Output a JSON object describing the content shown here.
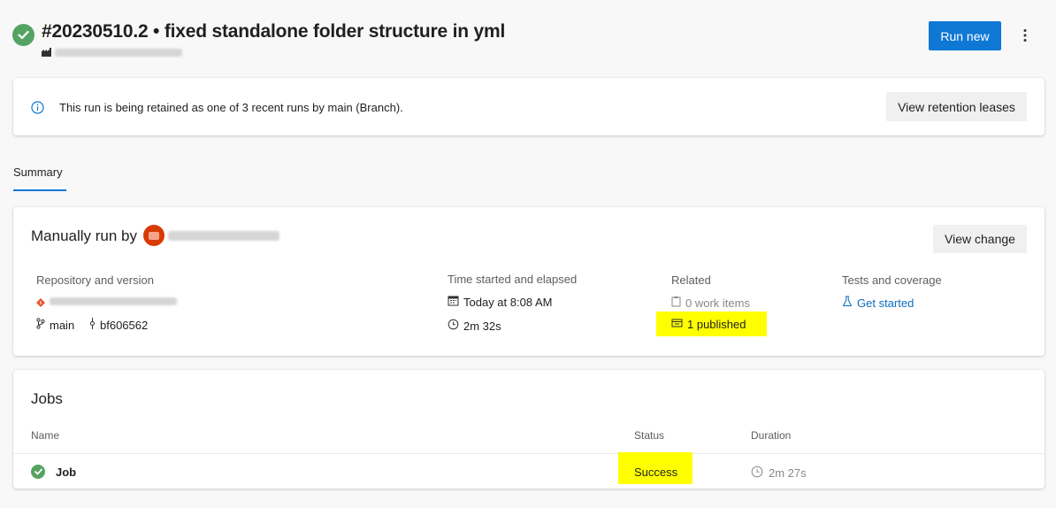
{
  "header": {
    "run_title": "#20230510.2 • fixed standalone folder structure in yml",
    "run_new_label": "Run new",
    "more_icon": "more-vertical-icon"
  },
  "retention": {
    "message": "This run is being retained as one of 3 recent runs by main (Branch).",
    "button_label": "View retention leases"
  },
  "tabs": [
    {
      "label": "Summary",
      "selected": true
    }
  ],
  "summary": {
    "triggered_label": "Manually run by",
    "view_change_label": "View change",
    "repository": {
      "heading": "Repository and version",
      "branch": "main",
      "commit": "bf606562"
    },
    "time": {
      "heading": "Time started and elapsed",
      "started": "Today at 8:08 AM",
      "elapsed": "2m 32s"
    },
    "related": {
      "heading": "Related",
      "work_items": "0 work items",
      "published": "1 published"
    },
    "tests": {
      "heading": "Tests and coverage",
      "get_started": "Get started"
    }
  },
  "jobs": {
    "title": "Jobs",
    "columns": {
      "name": "Name",
      "status": "Status",
      "duration": "Duration"
    },
    "rows": [
      {
        "name": "Job",
        "status": "Success",
        "duration": "2m 27s"
      }
    ]
  },
  "colors": {
    "accent": "#0f78d4",
    "success": "#55a362",
    "highlight": "#ffff00",
    "avatar": "#d83b01"
  }
}
